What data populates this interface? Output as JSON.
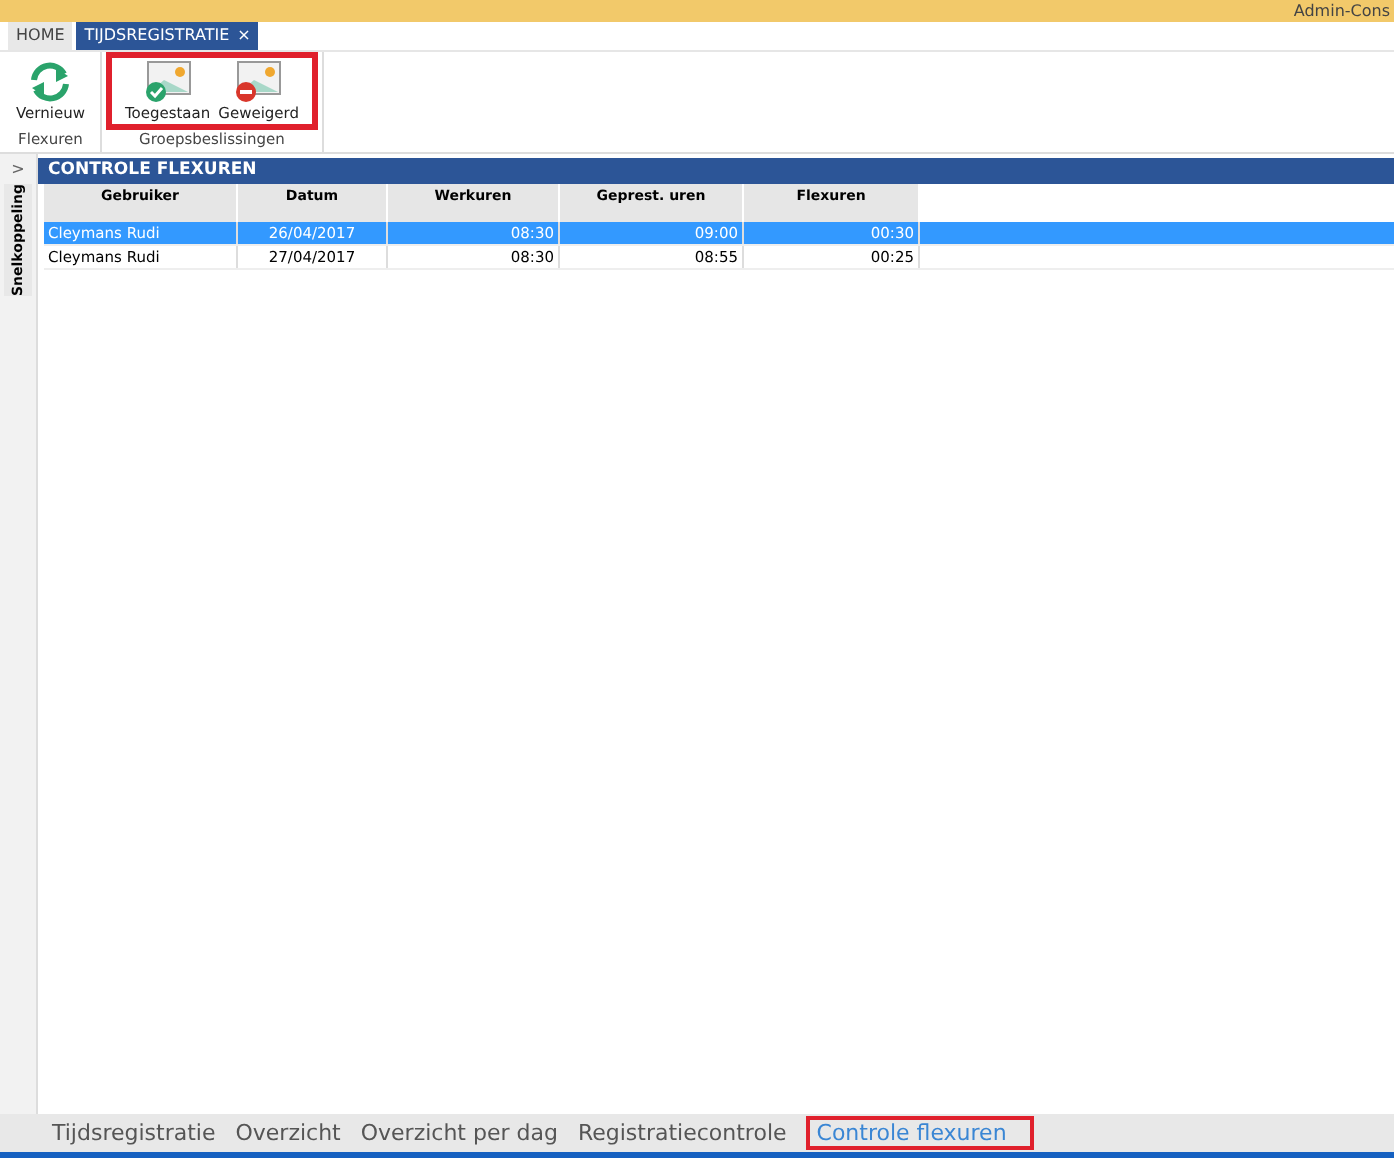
{
  "window": {
    "title": "Admin-Cons"
  },
  "tabs": [
    {
      "label": "HOME",
      "selected": false
    },
    {
      "label": "TIJDSREGISTRATIE",
      "selected": true,
      "close": "×"
    }
  ],
  "ribbon": {
    "groups": [
      {
        "label": "Flexuren",
        "highlighted": false,
        "buttons": [
          {
            "label": "Vernieuw",
            "kind": "refresh"
          }
        ]
      },
      {
        "label": "Groepsbeslissingen",
        "highlighted": true,
        "buttons": [
          {
            "label": "Toegestaan",
            "kind": "approve"
          },
          {
            "label": "Geweigerd",
            "kind": "deny"
          }
        ]
      }
    ]
  },
  "sidebar": {
    "toggle": ">",
    "label": "Snelkoppeling"
  },
  "panel": {
    "title": "CONTROLE FLEXUREN"
  },
  "table": {
    "columns": [
      "Gebruiker",
      "Datum",
      "Werkuren",
      "Geprest. uren",
      "Flexuren"
    ],
    "rows": [
      {
        "selected": true,
        "cells": [
          "Cleymans Rudi",
          "26/04/2017",
          "08:30",
          "09:00",
          "00:30"
        ]
      },
      {
        "selected": false,
        "cells": [
          "Cleymans Rudi",
          "27/04/2017",
          "08:30",
          "08:55",
          "00:25"
        ]
      }
    ]
  },
  "bottom_tabs": [
    {
      "label": "Tijdsregistratie",
      "selected": false
    },
    {
      "label": "Overzicht",
      "selected": false
    },
    {
      "label": "Overzicht per dag",
      "selected": false
    },
    {
      "label": "Registratiecontrole",
      "selected": false
    },
    {
      "label": "Controle flexuren",
      "selected": true
    }
  ]
}
